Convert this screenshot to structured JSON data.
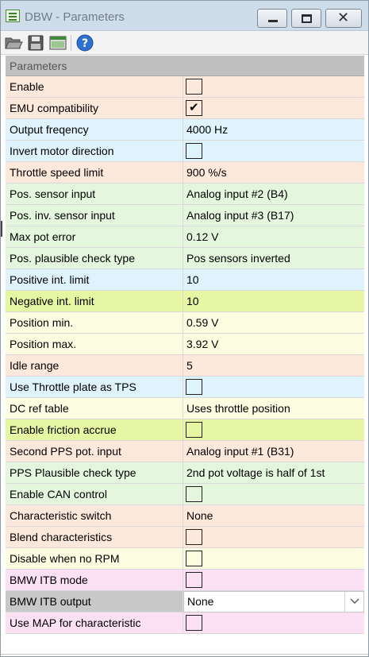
{
  "window": {
    "title": "DBW - Parameters",
    "colors": {
      "titlebar": "#cfdcea",
      "header": "#c0c0c0"
    }
  },
  "toolbar": {
    "icons": [
      "open-folder-icon",
      "save-icon",
      "view-window-icon",
      "help-icon"
    ]
  },
  "grid": {
    "header": "Parameters",
    "rows": [
      {
        "label": "Enable",
        "type": "checkbox",
        "checked": false,
        "color": "#fde8dc"
      },
      {
        "label": "EMU compatibility",
        "type": "checkbox",
        "checked": true,
        "color": "#fde8dc"
      },
      {
        "label": "Output freqency",
        "type": "text",
        "value": "4000 Hz",
        "color": "#def3fc"
      },
      {
        "label": "Invert motor direction",
        "type": "checkbox",
        "checked": false,
        "color": "#def3fc"
      },
      {
        "label": "Throttle speed limit",
        "type": "text",
        "value": "900 %/s",
        "color": "#fde8dc"
      },
      {
        "label": "Pos. sensor input",
        "type": "text",
        "value": "Analog input #2 (B4)",
        "color": "#e5f6df"
      },
      {
        "label": "Pos. inv. sensor input",
        "type": "text",
        "value": "Analog input #3 (B17)",
        "color": "#e5f6df"
      },
      {
        "label": "Max pot error",
        "type": "text",
        "value": "0.12 V",
        "color": "#e5f6df"
      },
      {
        "label": "Pos. plausible check type",
        "type": "text",
        "value": "Pos sensors inverted",
        "color": "#e5f6df"
      },
      {
        "label": "Positive int. limit",
        "type": "text",
        "value": "10",
        "color": "#def3fc"
      },
      {
        "label": "Negative int. limit",
        "type": "text",
        "value": "10",
        "color": "#e6f6a3"
      },
      {
        "label": "Position min.",
        "type": "text",
        "value": "0.59 V",
        "color": "#fdfde2"
      },
      {
        "label": "Position max.",
        "type": "text",
        "value": "3.92 V",
        "color": "#fdfde2"
      },
      {
        "label": "Idle range",
        "type": "text",
        "value": "5",
        "color": "#fde8dc"
      },
      {
        "label": "Use Throttle plate as TPS",
        "type": "checkbox",
        "checked": false,
        "color": "#def3fc"
      },
      {
        "label": "DC ref table",
        "type": "text",
        "value": "Uses throttle position",
        "color": "#fdfde2"
      },
      {
        "label": "Enable friction accrue",
        "type": "checkbox",
        "checked": false,
        "color": "#e6f6a3"
      },
      {
        "label": "Second PPS pot. input",
        "type": "text",
        "value": "Analog input #1 (B31)",
        "color": "#fde8dc"
      },
      {
        "label": "PPS Plausible check type",
        "type": "text",
        "value": "2nd pot voltage is half of 1st",
        "color": "#e5f6df"
      },
      {
        "label": "Enable CAN control",
        "type": "checkbox",
        "checked": false,
        "color": "#e5f6df"
      },
      {
        "label": "Characteristic switch",
        "type": "text",
        "value": "None",
        "color": "#fde8dc"
      },
      {
        "label": "Blend characteristics",
        "type": "checkbox",
        "checked": false,
        "color": "#fde8dc"
      },
      {
        "label": "Disable when no RPM",
        "type": "checkbox",
        "checked": false,
        "color": "#fdfde2"
      },
      {
        "label": "BMW ITB mode",
        "type": "checkbox",
        "checked": false,
        "color": "#fce0f4"
      },
      {
        "label": "BMW ITB output",
        "type": "dropdown",
        "value": "None",
        "color": "#c8c8c8"
      },
      {
        "label": "Use MAP for characteristic",
        "type": "checkbox",
        "checked": false,
        "color": "#fce0f4"
      }
    ]
  }
}
